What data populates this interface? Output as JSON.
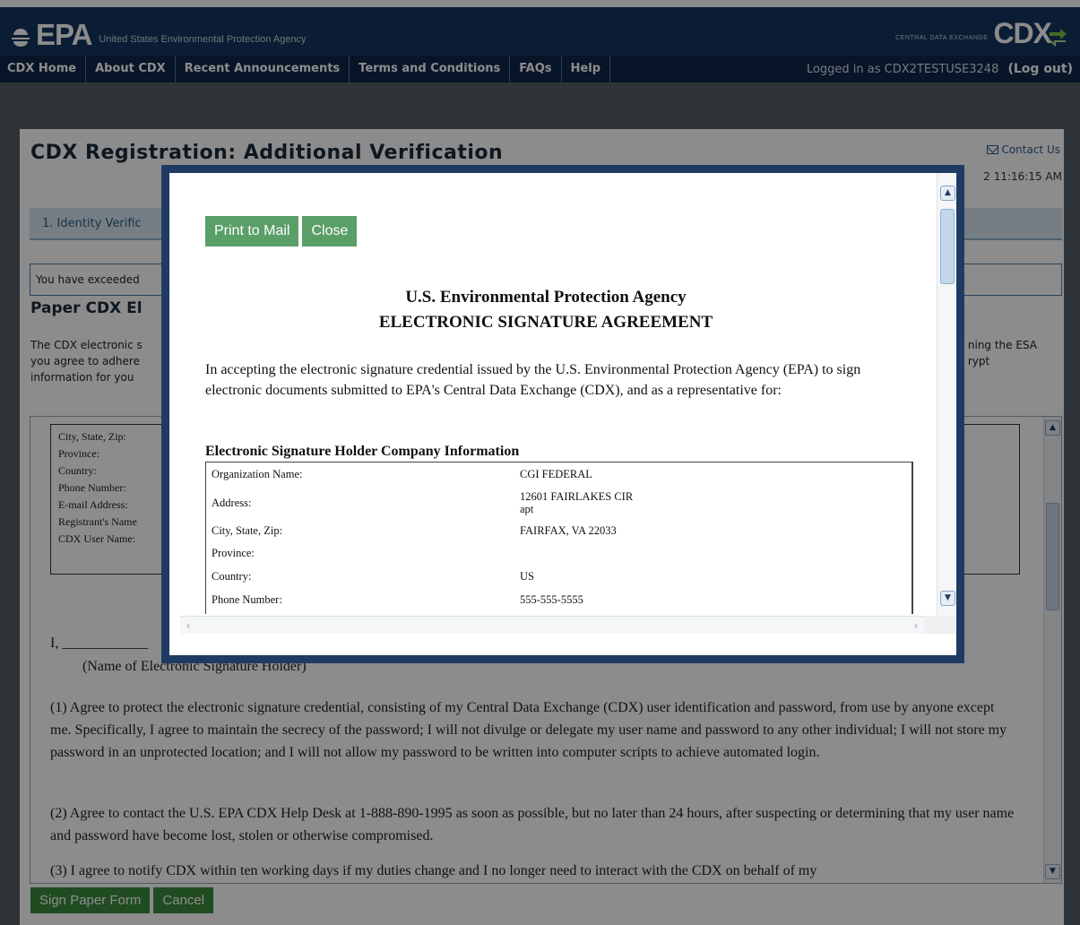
{
  "header": {
    "agency_short": "EPA",
    "agency_full": "United States Environmental Protection Agency",
    "cdx_small": "CENTRAL DATA EXCHANGE",
    "cdx_big": "CDX",
    "nav": [
      "CDX Home",
      "About CDX",
      "Recent Announcements",
      "Terms and Conditions",
      "FAQs",
      "Help"
    ],
    "logged_in_text": "Logged in as CDX2TESTUSE3248",
    "logout": "(Log out)"
  },
  "page": {
    "title": "CDX Registration: Additional Verification",
    "contact_us": "Contact Us",
    "timestamp": "2 11:16:15 AM",
    "step": "1. Identity Verific",
    "alert": "You have exceeded",
    "section_title": "Paper CDX El",
    "intro_lines": [
      "The CDX electronic s",
      "you agree to adhere",
      "information for you"
    ],
    "intro_right": [
      "ning the ESA",
      "rypt"
    ],
    "doc_rows": [
      "City, State, Zip:",
      "Province:",
      "Country:",
      "Phone Number:",
      "E-mail Address:",
      "Registrant's Name",
      "CDX User Name:"
    ],
    "signature_line": "I, ____________",
    "signature_caption": "(Name of Electronic Signature Holder)",
    "para1": "(1) Agree to protect the electronic signature credential, consisting of my Central Data Exchange (CDX) user identification and password, from use by anyone except me. Specifically, I agree to maintain the secrecy of the password; I will not divulge or delegate my user name and password to any other individual; I will not store my password in an unprotected location; and I will not allow my password to be written into computer scripts to achieve automated login.",
    "para2": "(2) Agree to contact the U.S. EPA CDX Help Desk at 1-888-890-1995 as soon as possible, but no later than 24 hours, after suspecting or determining that my user name and password have become lost, stolen or otherwise compromised.",
    "para3": "(3) I agree to notify CDX within ten working days if my duties change and I no longer need to interact with the CDX on behalf of my",
    "buttons": {
      "sign": "Sign Paper Form",
      "cancel": "Cancel"
    }
  },
  "modal": {
    "print_btn": "Print to Mail",
    "close_btn": "Close",
    "agency_line1": "U.S. Environmental Protection Agency",
    "agency_line2": "ELECTRONIC SIGNATURE AGREEMENT",
    "accept_text": "In accepting the electronic signature credential issued by the U.S. Environmental Protection Agency (EPA) to sign electronic documents submitted to EPA's Central Data Exchange (CDX), and as a representative for:",
    "company_heading": "Electronic Signature Holder Company Information",
    "company_rows": [
      {
        "label": "Organization Name:",
        "value": "CGI FEDERAL",
        "value2": ""
      },
      {
        "label": "Address:",
        "value": "12601 FAIRLAKES CIR",
        "value2": "apt"
      },
      {
        "label": "City, State, Zip:",
        "value": "FAIRFAX, VA 22033",
        "value2": ""
      },
      {
        "label": "Province:",
        "value": "",
        "value2": ""
      },
      {
        "label": "Country:",
        "value": "US",
        "value2": ""
      },
      {
        "label": "Phone Number:",
        "value": "555-555-5555",
        "value2": ""
      }
    ]
  },
  "colors": {
    "header_bg": "#15365f",
    "nav_bg": "#0f2749",
    "modal_border": "#1f3b63",
    "button_green": "#3b8a3f",
    "modal_button_green": "#5a9e68"
  }
}
